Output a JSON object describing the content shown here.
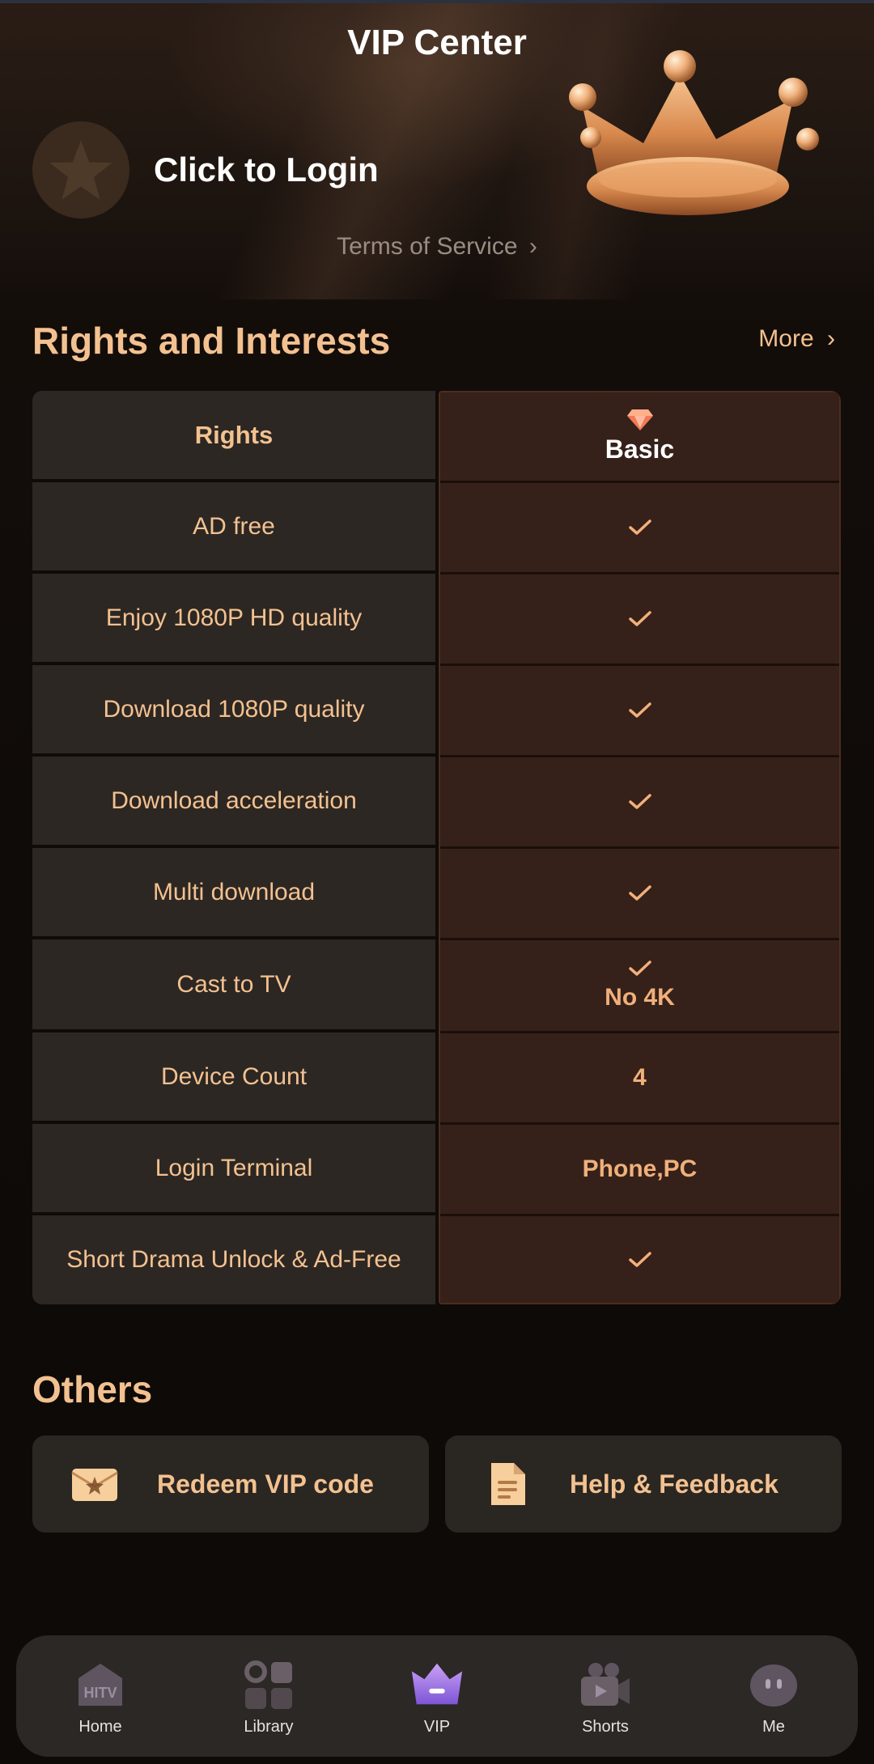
{
  "header": {
    "title": "VIP Center",
    "login_text": "Click to Login",
    "terms_text": "Terms of Service",
    "terms_chevron": "›"
  },
  "rights": {
    "section_title": "Rights and Interests",
    "more_label": "More",
    "more_chevron": "›",
    "table": {
      "left_header": "Rights",
      "right_header": "Basic",
      "rows": [
        {
          "right": "AD free",
          "value_check": true,
          "value_text": ""
        },
        {
          "right": "Enjoy 1080P HD quality",
          "value_check": true,
          "value_text": ""
        },
        {
          "right": "Download 1080P quality",
          "value_check": true,
          "value_text": ""
        },
        {
          "right": "Download acceleration",
          "value_check": true,
          "value_text": ""
        },
        {
          "right": "Multi download",
          "value_check": true,
          "value_text": ""
        },
        {
          "right": "Cast to TV",
          "value_check": true,
          "value_text": "No 4K"
        },
        {
          "right": "Device Count",
          "value_check": false,
          "value_text": "4"
        },
        {
          "right": "Login Terminal",
          "value_check": false,
          "value_text": "Phone,PC"
        },
        {
          "right": "Short Drama Unlock & Ad-Free",
          "value_check": true,
          "value_text": ""
        }
      ]
    }
  },
  "others": {
    "section_title": "Others",
    "cards": [
      {
        "label": "Redeem VIP code",
        "icon": "envelope-icon"
      },
      {
        "label": "Help & Feedback",
        "icon": "document-icon"
      }
    ]
  },
  "nav": {
    "items": [
      {
        "label": "Home",
        "icon": "hitv-home-icon"
      },
      {
        "label": "Library",
        "icon": "library-grid-icon"
      },
      {
        "label": "VIP",
        "icon": "vip-crown-icon"
      },
      {
        "label": "Shorts",
        "icon": "shorts-camera-icon"
      },
      {
        "label": "Me",
        "icon": "me-face-icon"
      }
    ]
  },
  "colors": {
    "accent": "#f3c190",
    "table_right_bg": "#36201a",
    "table_left_bg": "#2c2723",
    "card_bg": "#2a2622",
    "nav_bg": "#2b2826"
  }
}
